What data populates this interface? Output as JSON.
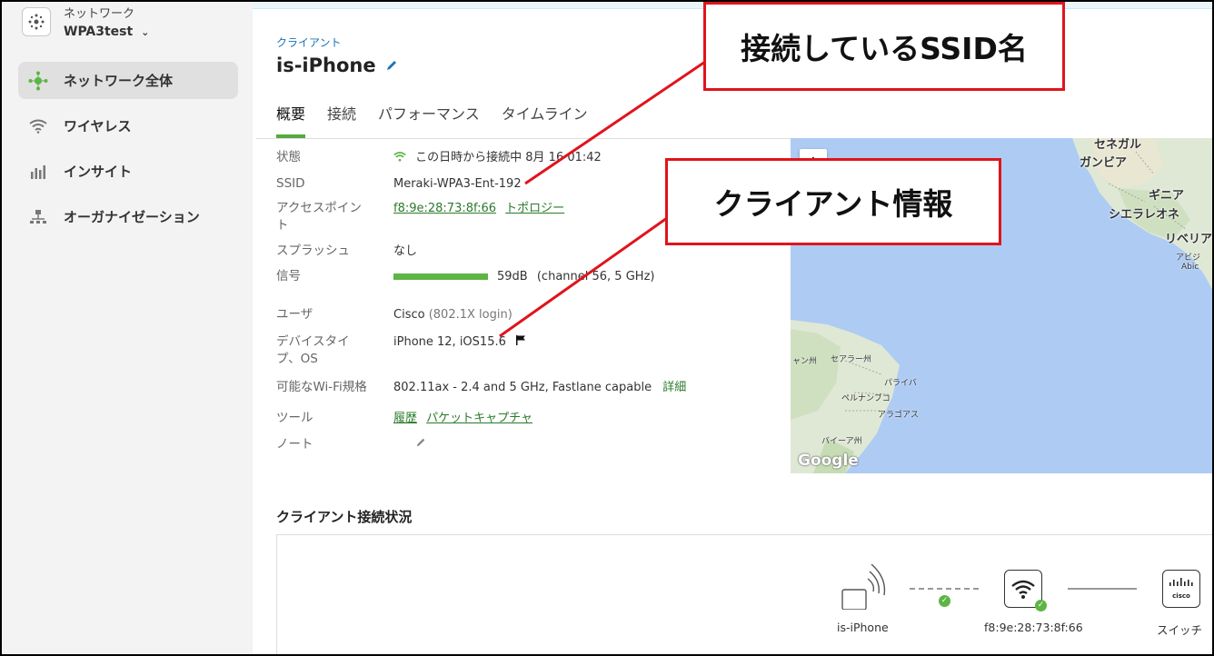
{
  "sidebar": {
    "network_label": "ネットワーク",
    "network_name": "WPA3test",
    "items": [
      {
        "label": "ネットワーク全体",
        "icon": "network-icon",
        "active": true
      },
      {
        "label": "ワイヤレス",
        "icon": "wifi-icon"
      },
      {
        "label": "インサイト",
        "icon": "bar-chart-icon"
      },
      {
        "label": "オーガナイゼーション",
        "icon": "organization-icon"
      }
    ]
  },
  "header": {
    "breadcrumb": "クライアント",
    "title": "is-iPhone",
    "tabs": [
      "概要",
      "接続",
      "パフォーマンス",
      "タイムライン"
    ],
    "active_tab": "概要"
  },
  "client_info": {
    "status_label": "状態",
    "status_value": "この日時から接続中 8月 16 01:42",
    "ssid_label": "SSID",
    "ssid_value": "Meraki-WPA3-Ent-192",
    "ap_label": "アクセスポイント",
    "ap_mac": "f8:9e:28:73:8f:66",
    "ap_topology": "トポロジー",
    "splash_label": "スプラッシュ",
    "splash_value": "なし",
    "signal_label": "信号",
    "signal_value": "59dB",
    "signal_detail": "(channel 56, 5 GHz)",
    "user_label": "ユーザ",
    "user_value": "Cisco",
    "user_detail": "(802.1X login)",
    "device_label": "デバイスタイプ、OS",
    "device_value": "iPhone 12, iOS15.6",
    "wifi_label": "可能なWi-Fi規格",
    "wifi_value": "802.11ax - 2.4 and 5 GHz, Fastlane capable",
    "wifi_detail": "詳細",
    "tools_label": "ツール",
    "tools_history": "履歴",
    "tools_capture": "パケットキャプチャ",
    "note_label": "ノート"
  },
  "map": {
    "zoom_in": "+",
    "attribution": "Google",
    "labels": {
      "senegal": "セネガル",
      "gambia": "ガンビア",
      "guinea": "ギニア",
      "sierra_leone": "シエラレオネ",
      "liberia": "リベリア",
      "abidjan": "アビジ",
      "abidjan_en": "Abic",
      "ceara": "セアラー州",
      "paraiba": "パライバ",
      "pernambuco": "ペルナンブコ",
      "alagoas": "アラゴアス",
      "bahia": "バイーア州",
      "maranhao": "ャン州"
    }
  },
  "connection": {
    "title": "クライアント接続状況",
    "client_name": "is-iPhone",
    "ap_name": "f8:9e:28:73:8f:66",
    "switch_name": "スイッチ",
    "switch_logo": "cisco"
  },
  "annotations": {
    "ssid_callout": "接続しているSSID名",
    "client_callout": "クライアント情報"
  },
  "colors": {
    "accent_green": "#5cb544",
    "link_green": "#2a7a2a",
    "link_blue": "#1a73b8",
    "callout_red": "#e0141c",
    "map_water": "#aecbf4"
  }
}
